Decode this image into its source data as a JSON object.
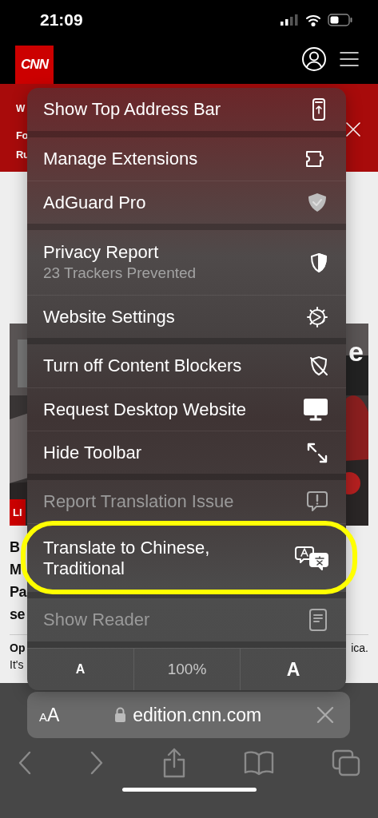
{
  "status_bar": {
    "time": "21:09"
  },
  "site_header": {
    "logo": "CNN"
  },
  "banner": {
    "fragments": [
      "W",
      "Fo",
      "Ru"
    ]
  },
  "story": {
    "picture": {
      "kind": "picture"
    },
    "overlay_text": "e",
    "label": "LI",
    "headline_fragments": [
      "B",
      "M",
      "Pa",
      "se"
    ],
    "summary_fragments": [
      "Op",
      "It's"
    ],
    "summary_tail": "ica."
  },
  "menu": {
    "sections": [
      [
        {
          "label": "Show Top Address Bar",
          "disabled": false,
          "circled": false
        }
      ],
      [
        {
          "label": "Manage Extensions",
          "disabled": false,
          "circled": false
        },
        {
          "label": "AdGuard Pro",
          "disabled": false,
          "circled": false
        }
      ],
      [
        {
          "label": "Privacy Report",
          "subtitle": "23 Trackers Prevented",
          "disabled": false,
          "circled": false
        },
        {
          "label": "Website Settings",
          "disabled": false,
          "circled": false
        }
      ],
      [
        {
          "label": "Turn off Content Blockers",
          "disabled": false,
          "circled": false
        },
        {
          "label": "Request Desktop Website",
          "disabled": false,
          "circled": false
        },
        {
          "label": "Hide Toolbar",
          "disabled": false,
          "circled": false
        }
      ],
      [
        {
          "label": "Report Translation Issue",
          "disabled": true,
          "circled": false
        },
        {
          "label": "Translate to Chinese, Traditional",
          "disabled": false,
          "circled": true
        }
      ],
      [
        {
          "label": "Show Reader",
          "disabled": true,
          "circled": false
        }
      ]
    ],
    "zoom": {
      "smaller": "A",
      "level": "100%",
      "larger": "A"
    }
  },
  "address_bar": {
    "text_size_small": "A",
    "text_size_large": "A",
    "url": "edition.cnn.com"
  }
}
